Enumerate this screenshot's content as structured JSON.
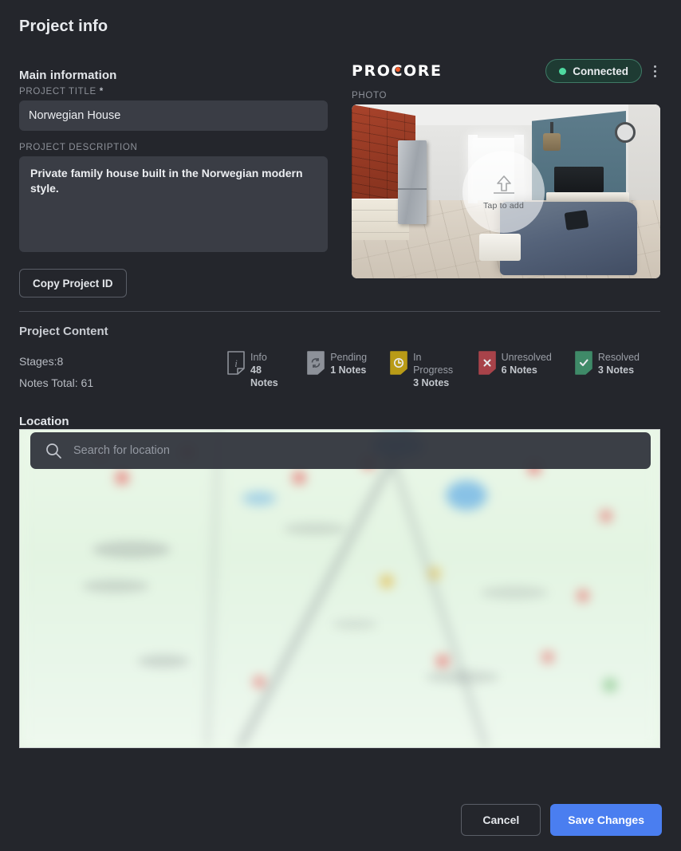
{
  "header": {
    "title": "Project info"
  },
  "main_information": {
    "heading": "Main information",
    "title_label": "PROJECT TITLE",
    "required_mark": "*",
    "title_value": "Norwegian House",
    "title_placeholder": "Project title",
    "description_label": "PROJECT DESCRIPTION",
    "description_value": "Private family house built in the Norwegian modern style.",
    "description_placeholder": "Project description",
    "copy_id_label": "Copy Project ID"
  },
  "integration": {
    "logo_text": "PROCORE",
    "logo_accent_color": "#f05a28",
    "status_label": "Connected",
    "status_color": "#4fd9a0",
    "menu_icon": "kebab-menu-icon"
  },
  "photo": {
    "label": "PHOTO",
    "overlay_text": "Tap to add",
    "overlay_icon": "upload-icon"
  },
  "project_content": {
    "heading": "Project Content",
    "stages_text": "Stages:8",
    "notes_total_text": "Notes Total: 61",
    "stats": [
      {
        "label": "Info",
        "count": "48 Notes",
        "icon": "info-note-icon",
        "color": "#8d9199",
        "fill": "none"
      },
      {
        "label": "Pending",
        "count": "1 Notes",
        "icon": "pending-note-icon",
        "color": "#8d9199",
        "fill": "#8d9199"
      },
      {
        "label": "In Progress",
        "count": "3 Notes",
        "icon": "in-progress-note-icon",
        "color": "#b99b17",
        "fill": "#b99b17"
      },
      {
        "label": "Unresolved",
        "count": "6 Notes",
        "icon": "unresolved-note-icon",
        "color": "#a8434a",
        "fill": "#a8434a"
      },
      {
        "label": "Resolved",
        "count": "3 Notes",
        "icon": "resolved-note-icon",
        "color": "#3f8a68",
        "fill": "#3f8a68"
      }
    ]
  },
  "location": {
    "heading": "Location",
    "search_placeholder": "Search for location",
    "search_value": "",
    "search_icon": "search-icon"
  },
  "footer": {
    "cancel_label": "Cancel",
    "save_label": "Save Changes",
    "save_color": "#4a7ef0"
  }
}
